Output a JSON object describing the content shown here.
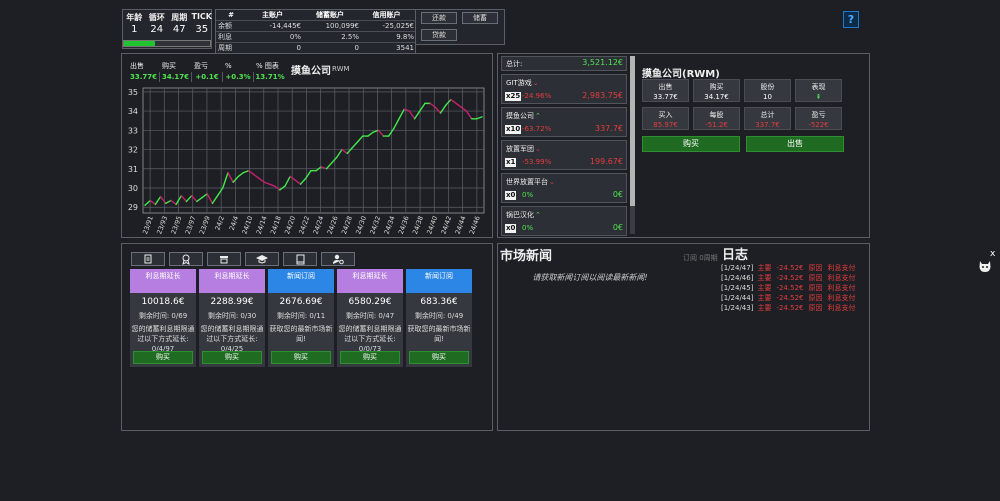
{
  "stats": {
    "headers": [
      "年龄",
      "循环",
      "周期",
      "TICK"
    ],
    "values": [
      "1",
      "24",
      "47",
      "35"
    ],
    "progress": 0.37
  },
  "account": {
    "headers": [
      "#",
      "主账户",
      "储蓄账户",
      "信用账户"
    ],
    "rows": [
      [
        "余额",
        "-14,445€",
        "100,099€",
        "-25,025€"
      ],
      [
        "利息",
        "0%",
        "2.5%",
        "9.8%"
      ],
      [
        "周期",
        "0",
        "0",
        "3541"
      ]
    ]
  },
  "top_buttons": {
    "repay": "还款",
    "savings": "储蓄",
    "loan": "贷款"
  },
  "help": "?",
  "chart_header": {
    "labels": [
      "出售",
      "购买",
      "盈亏",
      "%",
      "% 图表"
    ],
    "values": [
      "33.77€",
      "34.17€",
      "+0.1€",
      "+0.3%",
      "13.71%"
    ],
    "company": "摸鱼公司",
    "ticker": "RWM"
  },
  "chart_data": {
    "type": "line",
    "title": "摸鱼公司",
    "ylim": [
      28.7,
      35.2
    ],
    "yticks": [
      29,
      30,
      31,
      32,
      33,
      34,
      35
    ],
    "xticks": [
      "23/91",
      "23/93",
      "23/95",
      "23/97",
      "23/99",
      "24/2",
      "24/4",
      "24/10",
      "24/14",
      "24/18",
      "24/20",
      "24/22",
      "24/24",
      "24/26",
      "24/28",
      "24/30",
      "24/32",
      "24/34",
      "24/36",
      "24/38",
      "24/40",
      "24/42",
      "24/44",
      "24/46"
    ],
    "grid": true,
    "series": [
      {
        "values": [
          29.1,
          29.35,
          29.15,
          29.55,
          29.2,
          29.35,
          29.15,
          29.6,
          29.3,
          29.6,
          29.3,
          29.5,
          29.7,
          29.2,
          29.6,
          30.0,
          30.8,
          30.3,
          30.6,
          30.8,
          30.9,
          30.7,
          30.5,
          30.3,
          30.2,
          30.1,
          29.9,
          30.1,
          30.6,
          30.4,
          30.2,
          30.5,
          30.9,
          30.9,
          31.1,
          31.0,
          31.3,
          31.6,
          32.0,
          31.8,
          32.1,
          32.4,
          32.7,
          32.7,
          32.9,
          33.0,
          32.7,
          32.7,
          33.1,
          33.6,
          34.1,
          34.0,
          33.6,
          34.0,
          34.4,
          34.4,
          34.2,
          33.9,
          34.3,
          34.6,
          34.4,
          34.2,
          34.0,
          33.6,
          33.6,
          33.7
        ]
      }
    ]
  },
  "portfolio": {
    "total_label": "总计:",
    "total_value": "3,521.12€",
    "items": [
      {
        "name": "GIT游戏",
        "qty": "x25",
        "pct": "-24.96%",
        "value": "2,983.75€",
        "trend": "down"
      },
      {
        "name": "摸鱼公司",
        "qty": "x10",
        "pct": "-63.72%",
        "value": "337.7€",
        "trend": "up"
      },
      {
        "name": "放置军团",
        "qty": "x1",
        "pct": "-53.99%",
        "value": "199.67€",
        "trend": "down"
      },
      {
        "name": "世界放置平台",
        "qty": "x0",
        "pct": "0%",
        "value": "0€",
        "trend": "down"
      },
      {
        "name": "锅巴汉化",
        "qty": "x0",
        "pct": "0%",
        "value": "0€",
        "trend": "up"
      }
    ]
  },
  "detail": {
    "title": "摸鱼公司(RWM)",
    "row1": [
      {
        "label": "出售",
        "value": "33.77€",
        "color": "#ffffff"
      },
      {
        "label": "购买",
        "value": "34.17€",
        "color": "#ffffff"
      },
      {
        "label": "股份",
        "value": "10",
        "color": "#ffffff"
      },
      {
        "label": "表现",
        "value": "⇞",
        "color": "#4fe34f"
      }
    ],
    "row2": [
      {
        "label": "买入",
        "value": "85.97€",
        "color": "#e23d3d"
      },
      {
        "label": "每股",
        "value": "-51.2€",
        "color": "#e23d3d"
      },
      {
        "label": "总计",
        "value": "337.7€",
        "color": "#e23d3d"
      },
      {
        "label": "盈亏",
        "value": "-522€",
        "color": "#e23d3d"
      }
    ],
    "buy": "购买",
    "sell": "出售"
  },
  "upgrades": [
    {
      "title": "利息期延长",
      "price": "10018.6€",
      "time_label": "剩余时间:",
      "time": "0/69",
      "desc": "您的储蓄利息期限通过以下方式延长: 0/4/97",
      "buy": "购买",
      "color": "purple"
    },
    {
      "title": "利息期延长",
      "price": "2288.99€",
      "time_label": "剩余时间:",
      "time": "0/30",
      "desc": "您的储蓄利息期限通过以下方式延长: 0/4/25",
      "buy": "购买",
      "color": "purple"
    },
    {
      "title": "新闻订阅",
      "price": "2676.69€",
      "time_label": "剩余时间:",
      "time": "0/11",
      "desc": "获取您的最新市场新闻!",
      "buy": "购买",
      "color": "blue"
    },
    {
      "title": "利息期延长",
      "price": "6580.29€",
      "time_label": "剩余时间:",
      "time": "0/47",
      "desc": "您的储蓄利息期限通过以下方式延长: 0/0/73",
      "buy": "购买",
      "color": "purple"
    },
    {
      "title": "新闻订阅",
      "price": "683.36€",
      "time_label": "剩余时间:",
      "time": "0/49",
      "desc": "获取您的最新市场新闻!",
      "buy": "购买",
      "color": "blue"
    }
  ],
  "news": {
    "title": "市场新闻",
    "subscription": "订阅 0周期",
    "message": "请获取新闻订阅以阅读最新新闻!"
  },
  "log": {
    "title": "日志",
    "entries": [
      {
        "date": "[1/24/47]",
        "a": "主要",
        "b": "-24.52€",
        "c": "原因",
        "d": "利息支付"
      },
      {
        "date": "[1/24/46]",
        "a": "主要",
        "b": "-24.52€",
        "c": "原因",
        "d": "利息支付"
      },
      {
        "date": "[1/24/45]",
        "a": "主要",
        "b": "-24.52€",
        "c": "原因",
        "d": "利息支付"
      },
      {
        "date": "[1/24/44]",
        "a": "主要",
        "b": "-24.52€",
        "c": "原因",
        "d": "利息支付"
      },
      {
        "date": "[1/24/43]",
        "a": "主要",
        "b": "-24.52€",
        "c": "原因",
        "d": "利息支付"
      }
    ]
  },
  "close": "x"
}
